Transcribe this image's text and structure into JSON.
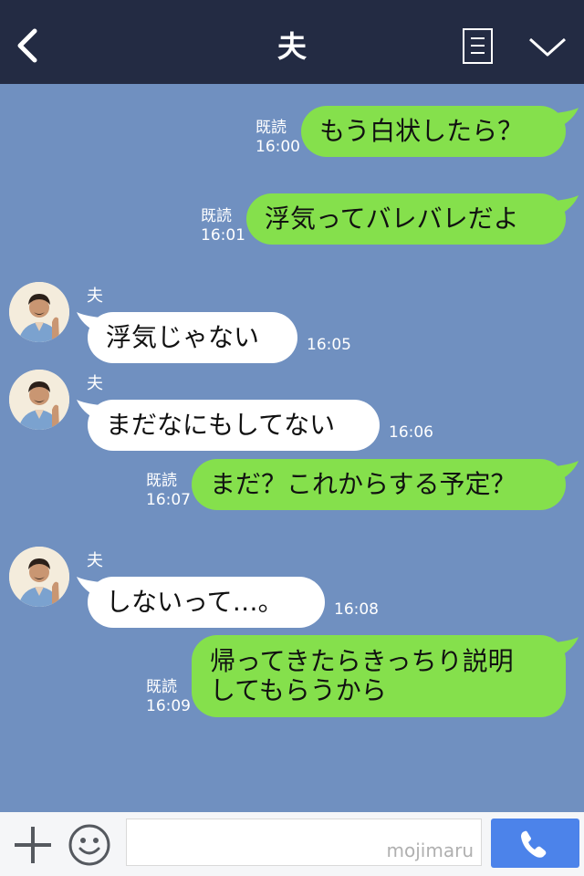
{
  "header": {
    "title": "夫",
    "back_icon": "chevron-left-icon",
    "menu_icon": "menu-icon",
    "collapse_icon": "chevron-down-icon"
  },
  "colors": {
    "header_bg": "#232b43",
    "chat_bg": "#7090c0",
    "sent_bubble": "#85e04c",
    "received_bubble": "#ffffff",
    "call_button": "#4c83ea"
  },
  "messages": [
    {
      "sender": "self",
      "text": "もう白状したら？",
      "read_label": "既読",
      "time": "16:00"
    },
    {
      "sender": "self",
      "text": "浮気ってバレバレだよ",
      "read_label": "既読",
      "time": "16:01"
    },
    {
      "sender": "other",
      "name": "夫",
      "text": "浮気じゃない",
      "time": "16:05"
    },
    {
      "sender": "other",
      "name": "夫",
      "text": "まだなにもしてない",
      "time": "16:06"
    },
    {
      "sender": "self",
      "text": "まだ？これからする予定？",
      "read_label": "既読",
      "time": "16:07"
    },
    {
      "sender": "other",
      "name": "夫",
      "text": "しないって…。",
      "time": "16:08"
    },
    {
      "sender": "self",
      "lines": [
        "帰ってきたらきっちり説明",
        "してもらうから"
      ],
      "read_label": "既読",
      "time": "16:09"
    }
  ],
  "input_bar": {
    "plus_icon": "plus-icon",
    "emoji_icon": "smiley-icon",
    "input_value": "",
    "watermark": "mojimaru",
    "call_icon": "phone-icon"
  }
}
